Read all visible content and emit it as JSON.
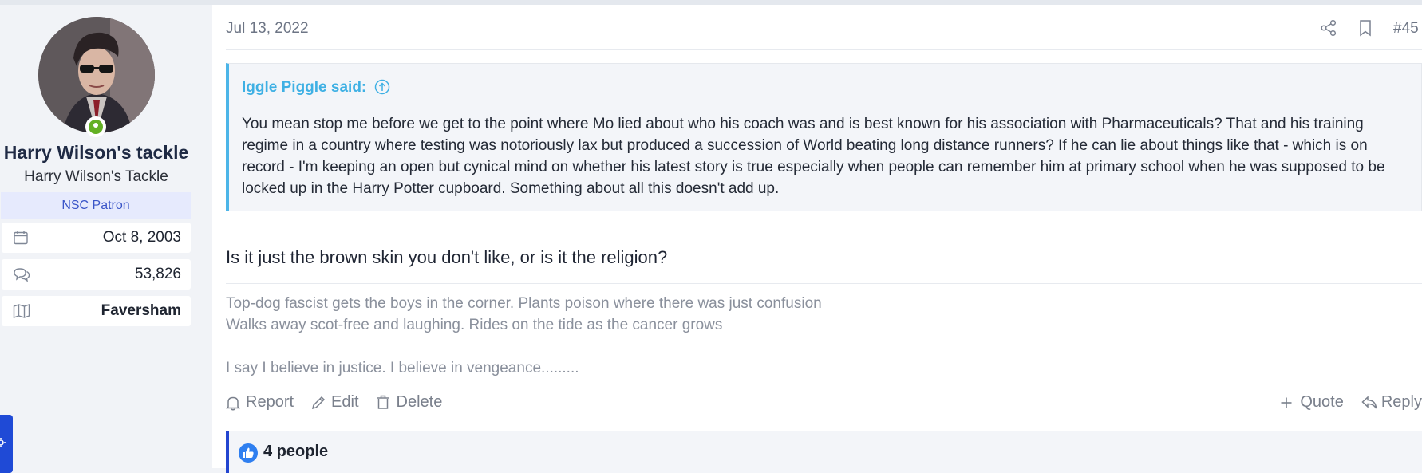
{
  "user": {
    "name": "Harry Wilson's tackle",
    "title": "Harry Wilson's Tackle",
    "banner": "NSC Patron",
    "joined": "Oct 8, 2003",
    "messages": "53,826",
    "location": "Faversham"
  },
  "post": {
    "date": "Jul 13, 2022",
    "number": "#45",
    "quote": {
      "author": "Iggle Piggle said:",
      "text": "You mean stop me before we get to the point where Mo lied about who his coach was and is best known for his association with Pharmaceuticals? That and his training regime in a country where testing was notoriously lax but produced a succession of World beating long distance runners? If he can lie about things like that - which is on record - I'm keeping an open but cynical mind on whether his latest story is true especially when people can remember him at primary school when he was supposed to be locked up in the Harry Potter cupboard. Something about all this doesn't add up."
    },
    "body": "Is it just the brown skin you don't like, or is it the religion?",
    "signature": {
      "line1": "Top-dog fascist gets the boys in the corner. Plants poison where there was just confusion",
      "line2": "Walks away scot-free and laughing. Rides on the tide as the cancer grows",
      "line3": "I say I believe in justice. I believe in vengeance........."
    },
    "actions": {
      "report": "Report",
      "edit": "Edit",
      "delete": "Delete",
      "quote": "Quote",
      "reply": "Reply"
    },
    "reactions": "4 people"
  },
  "icons": {
    "share": "share-icon",
    "bookmark": "bookmark-icon",
    "calendar": "calendar-icon",
    "messages": "chat-bubbles-icon",
    "location": "map-icon",
    "like": "thumbs-up-icon"
  },
  "colors": {
    "accent": "#2345d0",
    "quote_accent": "#3eb0e4",
    "online": "#63b024"
  }
}
